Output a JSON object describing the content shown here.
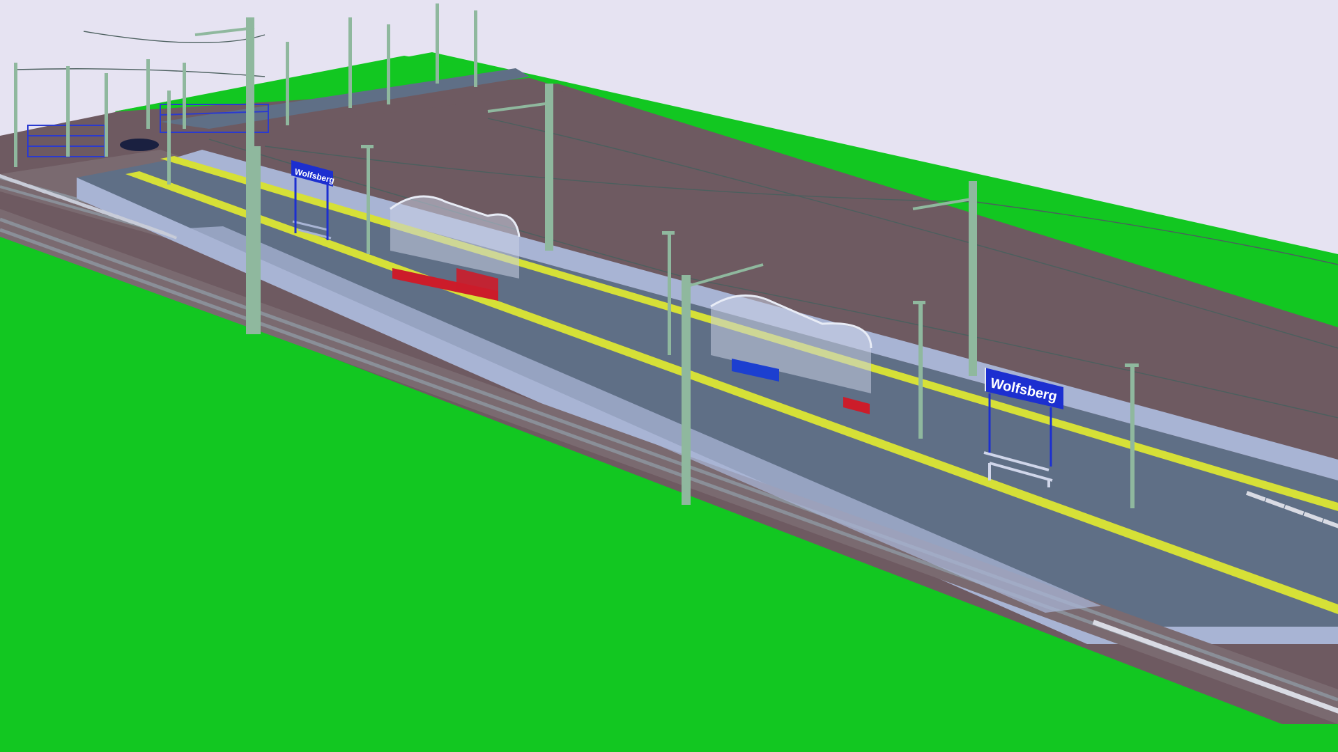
{
  "scene": {
    "station_name_far": "Wolfsberg",
    "station_name_near": "Wolfsberg"
  },
  "colors": {
    "sky": "#e6e3f2",
    "grass": "#12c721",
    "ballast": "#6e5a61",
    "platform": "#5f6f86",
    "platform_edge_light": "#a8b4d4",
    "safety_line": "#d6e037",
    "rail": "#8a8f98",
    "sleeper": "#d9dbe4",
    "mast": "#8fb89e",
    "catenary_wire": "#4b5f5e",
    "sign_blue": "#1c2fd0",
    "shelter_glass": "#c8d0e4",
    "shelter_red": "#cc1c2a",
    "shelter_blue": "#1c3fd0",
    "fence_blue": "#2a3ad0",
    "car": "#1a2040"
  },
  "icons": {
    "station_sign": "station-sign",
    "shelter": "platform-shelter",
    "bench": "bench",
    "lamp": "lamp-post",
    "mast": "catenary-mast",
    "car": "car"
  }
}
